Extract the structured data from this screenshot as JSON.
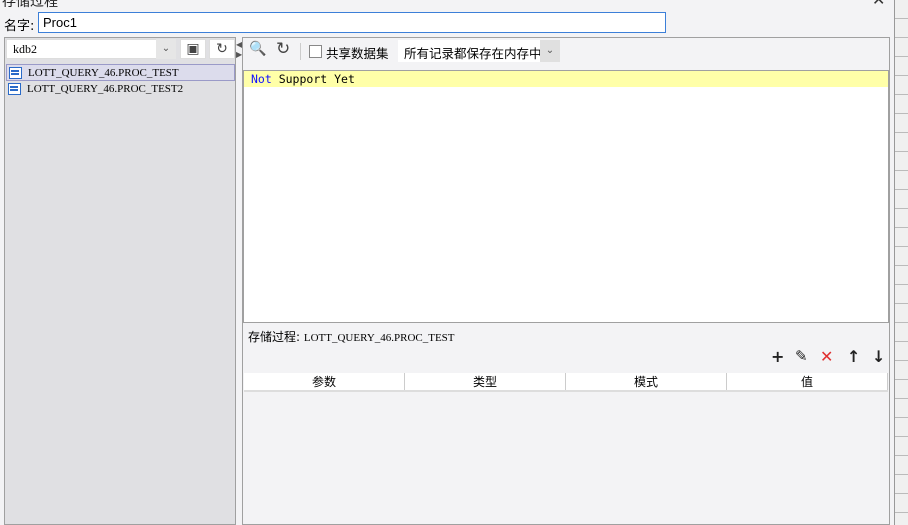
{
  "window": {
    "title": "存储过程",
    "close": "✕"
  },
  "name": {
    "label": "名字:",
    "value": "Proc1"
  },
  "left": {
    "db": "kdb2",
    "items": [
      "LOTT_QUERY_46.PROC_TEST",
      "LOTT_QUERY_46.PROC_TEST2"
    ]
  },
  "toolbar": {
    "share_label": "共享数据集",
    "memory_option": "所有记录都保存在内存中"
  },
  "editor": {
    "keyword": "Not",
    "rest": " Support Yet"
  },
  "proc": {
    "label": "存储过程:",
    "value": "LOTT_QUERY_46.PROC_TEST"
  },
  "params": {
    "columns": [
      "参数",
      "类型",
      "模式",
      "值"
    ]
  }
}
